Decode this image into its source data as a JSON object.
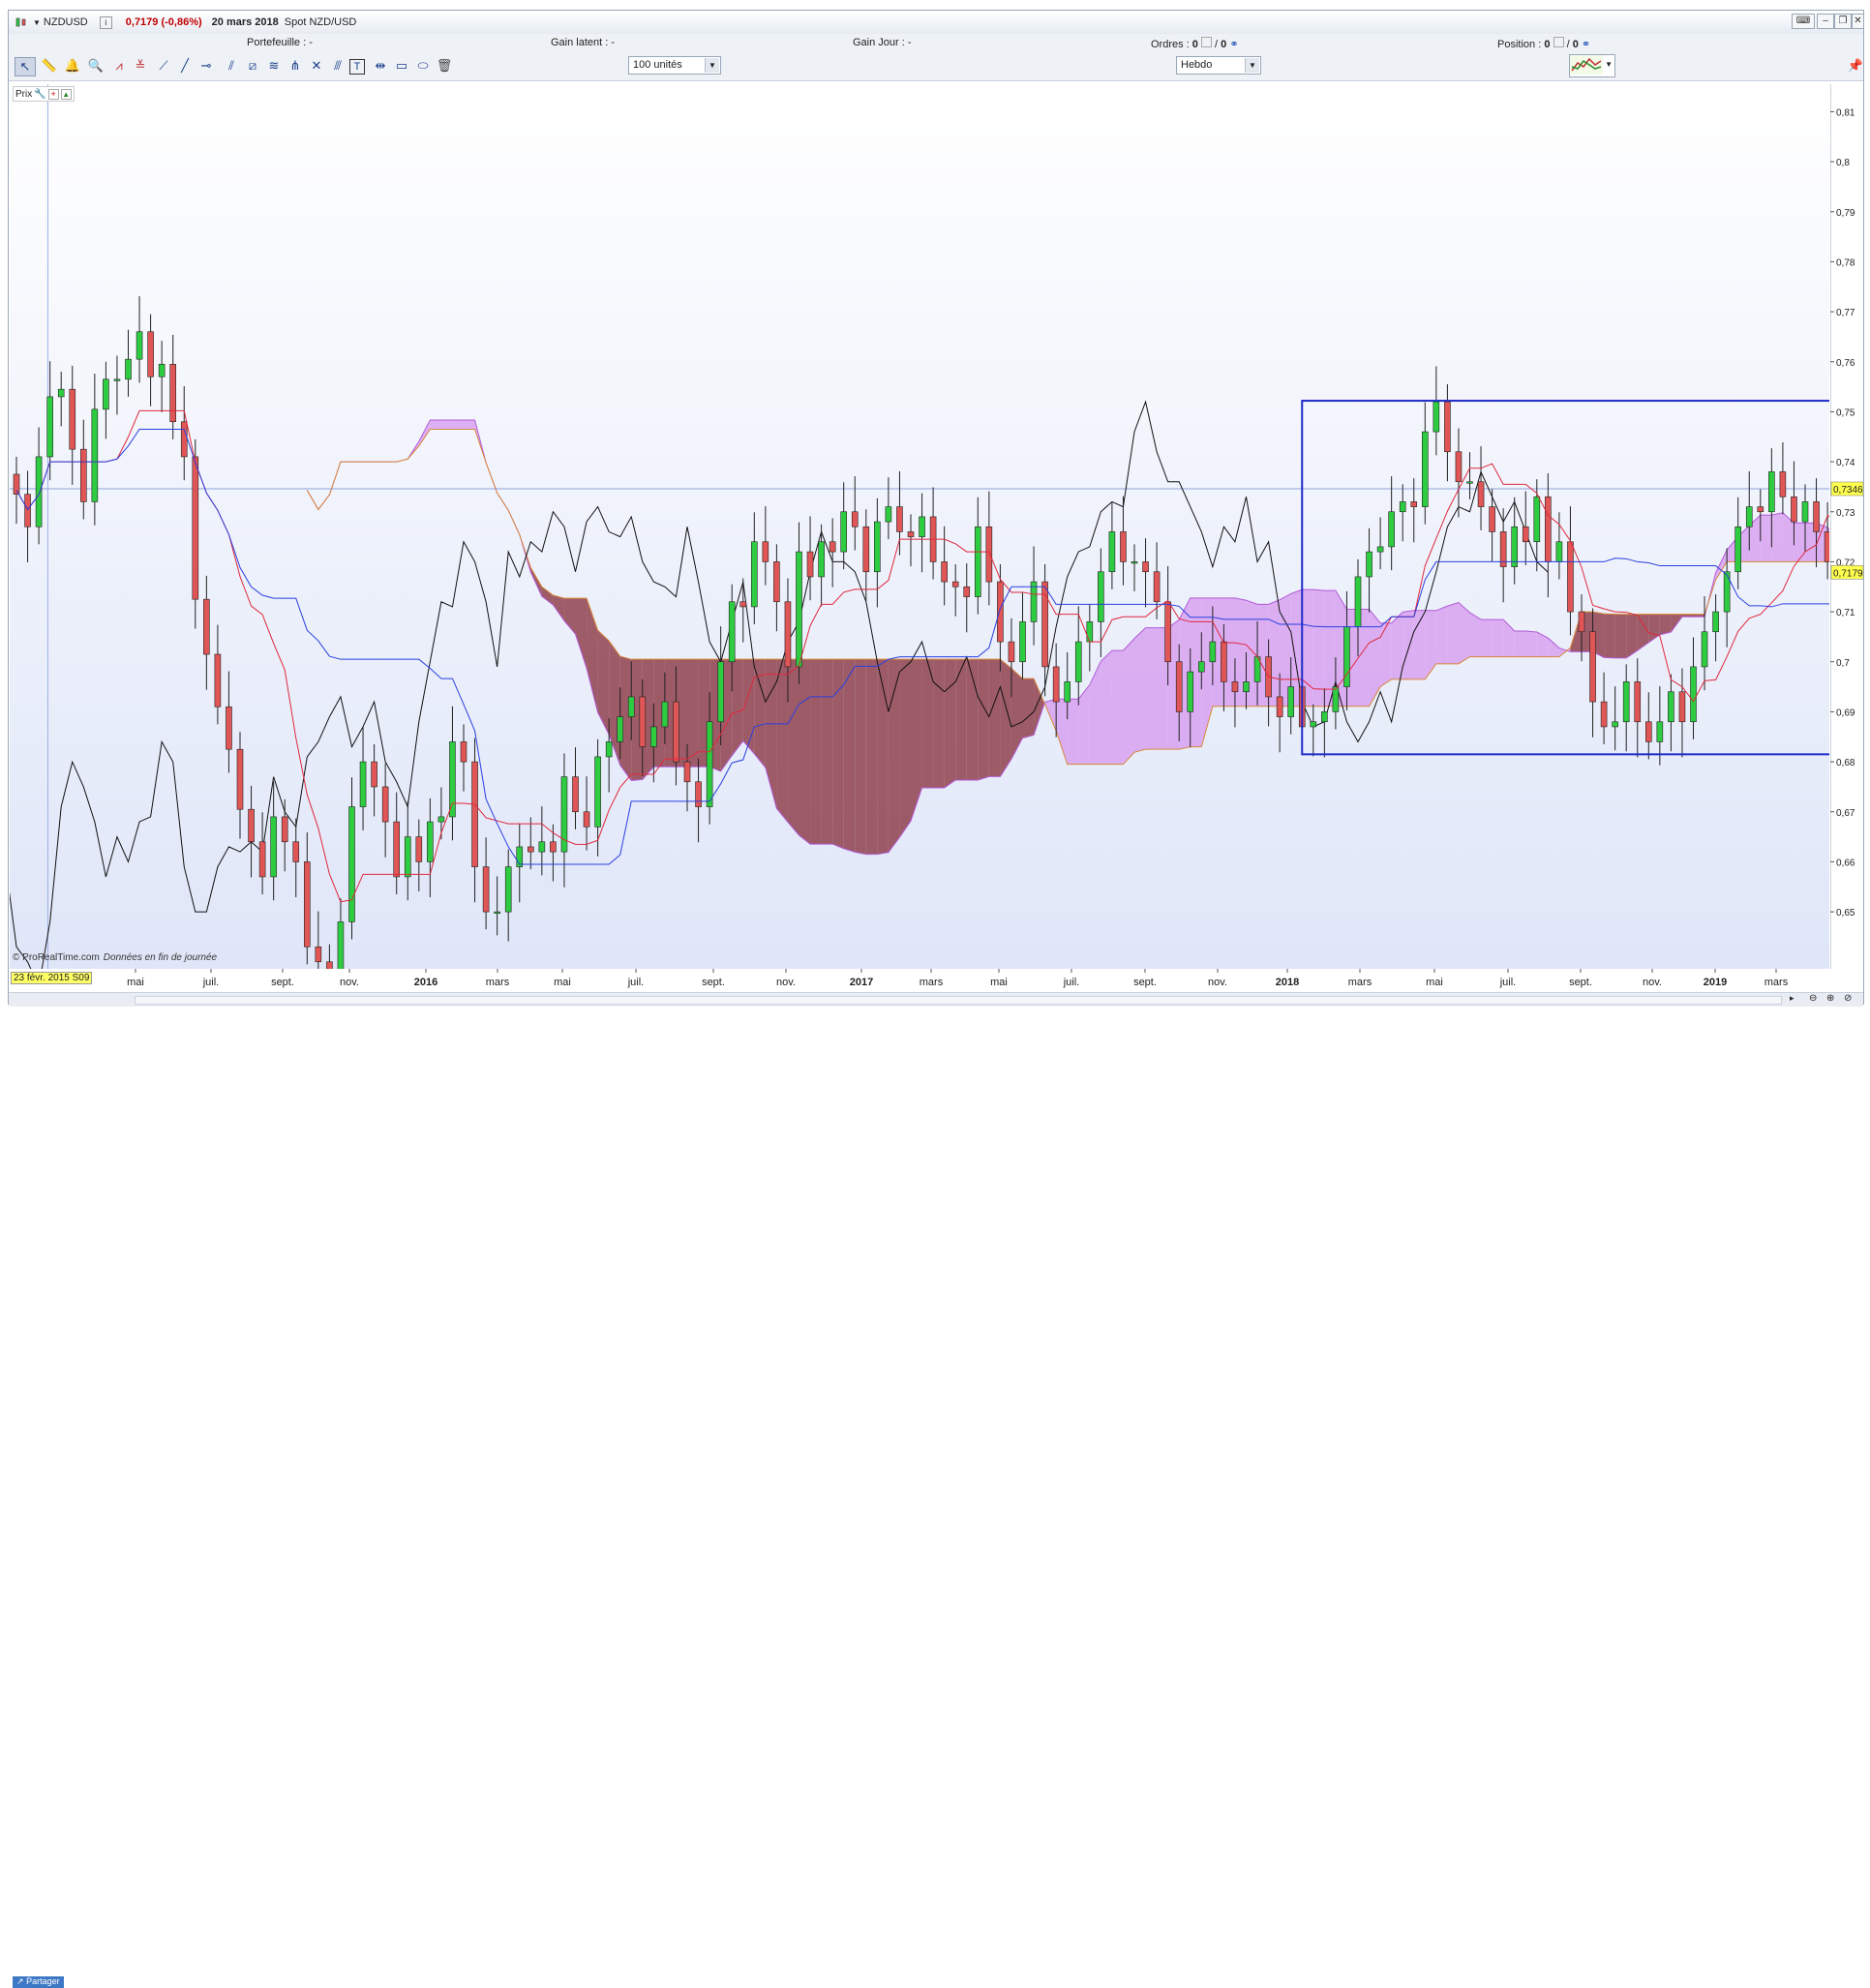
{
  "header": {
    "instrument": "NZDUSD",
    "price_change": "0,7179 (-0,86%)",
    "date": "20 mars 2018",
    "description": "Spot NZD/USD"
  },
  "status": {
    "portefeuille": "Portefeuille : -",
    "gain_latent": "Gain latent : -",
    "gain_jour": "Gain Jour : -",
    "ordres_label": "Ordres :",
    "ordres_value": "0",
    "ordres_sep": "/",
    "ordres_value2": "0",
    "position_label": "Position :",
    "position_value": "0",
    "position_sep": "/",
    "position_value2": "0"
  },
  "toolbar": {
    "quantity": "100 unités",
    "period": "Hebdo"
  },
  "panel": {
    "label": "Prix"
  },
  "footer": {
    "credit": "© ProRealTime.com",
    "credit_note": "Données en fin de journée",
    "cursor_date": "23 févr. 2015 S09",
    "share_label": "Partager"
  },
  "colors": {
    "bull": "#2ecc40",
    "bear": "#e05555",
    "tenkan": "#e0283c",
    "kijun": "#2a3ee0",
    "chikou": "#111111",
    "kumo_bear": "#8c3a48",
    "kumo_bull": "#d69bf0",
    "box": "#1e2cc8"
  },
  "chart_data": {
    "type": "candlestick",
    "symbol": "NZDUSD",
    "timeframe": "Hebdo",
    "y_ticks": [
      "0,65",
      "0,66",
      "0,67",
      "0,68",
      "0,69",
      "0,7",
      "0,71",
      "0,72",
      "0,73",
      "0,74",
      "0,75",
      "0,76",
      "0,77",
      "0,78",
      "0,79",
      "0,8",
      "0,81"
    ],
    "y_range": [
      0.6386,
      0.8155
    ],
    "x_ticks": [
      "mai",
      "juil.",
      "sept.",
      "nov.",
      "2016",
      "mars",
      "mai",
      "juil.",
      "sept.",
      "nov.",
      "2017",
      "mars",
      "mai",
      "juil.",
      "sept.",
      "nov.",
      "2018",
      "mars",
      "mai",
      "juil.",
      "sept.",
      "nov.",
      "2019",
      "mars"
    ],
    "price_labels": [
      {
        "value": 0.7346,
        "label": "0,7346"
      },
      {
        "value": 0.7179,
        "label": "0,7179"
      }
    ],
    "crosshair_price": 0.7346,
    "closes": [
      0.7335,
      0.727,
      0.741,
      0.753,
      0.7545,
      0.7425,
      0.732,
      0.7505,
      0.7565,
      0.7565,
      0.7605,
      0.766,
      0.757,
      0.7595,
      0.748,
      0.741,
      0.7125,
      0.7015,
      0.691,
      0.6825,
      0.6705,
      0.664,
      0.657,
      0.669,
      0.664,
      0.66,
      0.643,
      0.64,
      0.635,
      0.648,
      0.671,
      0.68,
      0.675,
      0.668,
      0.657,
      0.665,
      0.66,
      0.668,
      0.669,
      0.684,
      0.68,
      0.659,
      0.65,
      0.65,
      0.659,
      0.663,
      0.662,
      0.664,
      0.662,
      0.677,
      0.67,
      0.667,
      0.681,
      0.684,
      0.689,
      0.693,
      0.683,
      0.687,
      0.692,
      0.68,
      0.676,
      0.671,
      0.688,
      0.7,
      0.712,
      0.711,
      0.724,
      0.72,
      0.712,
      0.699,
      0.722,
      0.717,
      0.724,
      0.722,
      0.73,
      0.727,
      0.718,
      0.728,
      0.731,
      0.726,
      0.725,
      0.729,
      0.72,
      0.716,
      0.715,
      0.713,
      0.727,
      0.716,
      0.704,
      0.7,
      0.708,
      0.716,
      0.699,
      0.692,
      0.696,
      0.704,
      0.708,
      0.718,
      0.726,
      0.72,
      0.72,
      0.718,
      0.712,
      0.7,
      0.69,
      0.698,
      0.7,
      0.704,
      0.696,
      0.694,
      0.696,
      0.701,
      0.693,
      0.689,
      0.695,
      0.687,
      0.688,
      0.69,
      0.695,
      0.707,
      0.717,
      0.722,
      0.723,
      0.73,
      0.732,
      0.731,
      0.746,
      0.752,
      0.742,
      0.736,
      0.736,
      0.731,
      0.726,
      0.719,
      0.727,
      0.724,
      0.733,
      0.72,
      0.724,
      0.71,
      0.706,
      0.692,
      0.687,
      0.688,
      0.696,
      0.688,
      0.684,
      0.688,
      0.694,
      0.688,
      0.699,
      0.706,
      0.71,
      0.718,
      0.727,
      0.731,
      0.73,
      0.738,
      0.733,
      0.728,
      0.732,
      0.726,
      0.72,
      0.7179
    ],
    "series": [
      {
        "name": "Tenkan-sen",
        "role": "tenkan"
      },
      {
        "name": "Kijun-sen",
        "role": "kijun"
      },
      {
        "name": "Chikou Span",
        "role": "chikou"
      },
      {
        "name": "Kumo",
        "role": "kumo"
      }
    ],
    "rectangle": {
      "x_start_index": 115,
      "x_end_index": 168,
      "y_low": 0.6815,
      "y_high": 0.7522
    }
  }
}
